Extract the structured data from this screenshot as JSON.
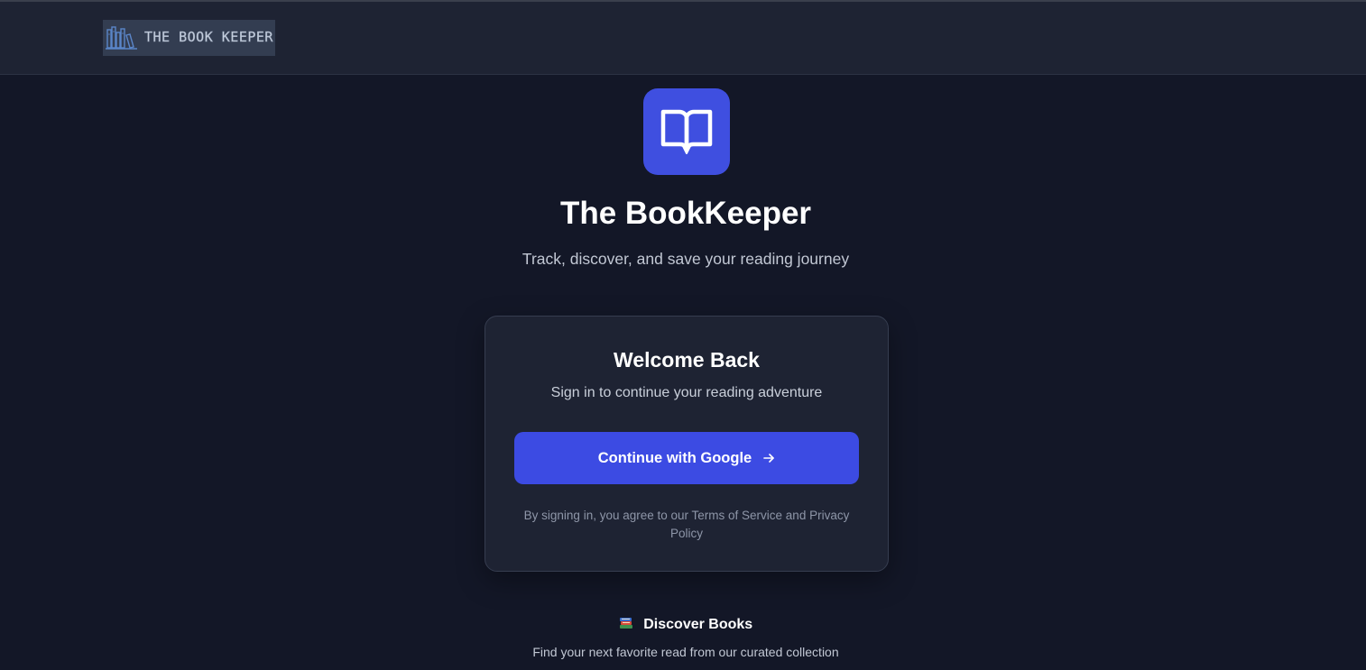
{
  "header": {
    "logo_text": "THE BOOK KEEPER"
  },
  "hero": {
    "icon": "open-book-icon",
    "title": "The BookKeeper",
    "subtitle": "Track, discover, and save your reading journey"
  },
  "card": {
    "title": "Welcome Back",
    "subtitle": "Sign in to continue your reading adventure",
    "button_label": "Continue with Google",
    "button_icon": "arrow-right-icon",
    "legal_text": "By signing in, you agree to our Terms of Service and Privacy Policy"
  },
  "discover": {
    "icon": "books-emoji-icon",
    "title": "Discover Books",
    "subtitle": "Find your next favorite read from our curated collection"
  },
  "colors": {
    "background": "#131727",
    "header_bg": "#1e2333",
    "card_bg": "#1e2333",
    "accent": "#3c4be3"
  }
}
